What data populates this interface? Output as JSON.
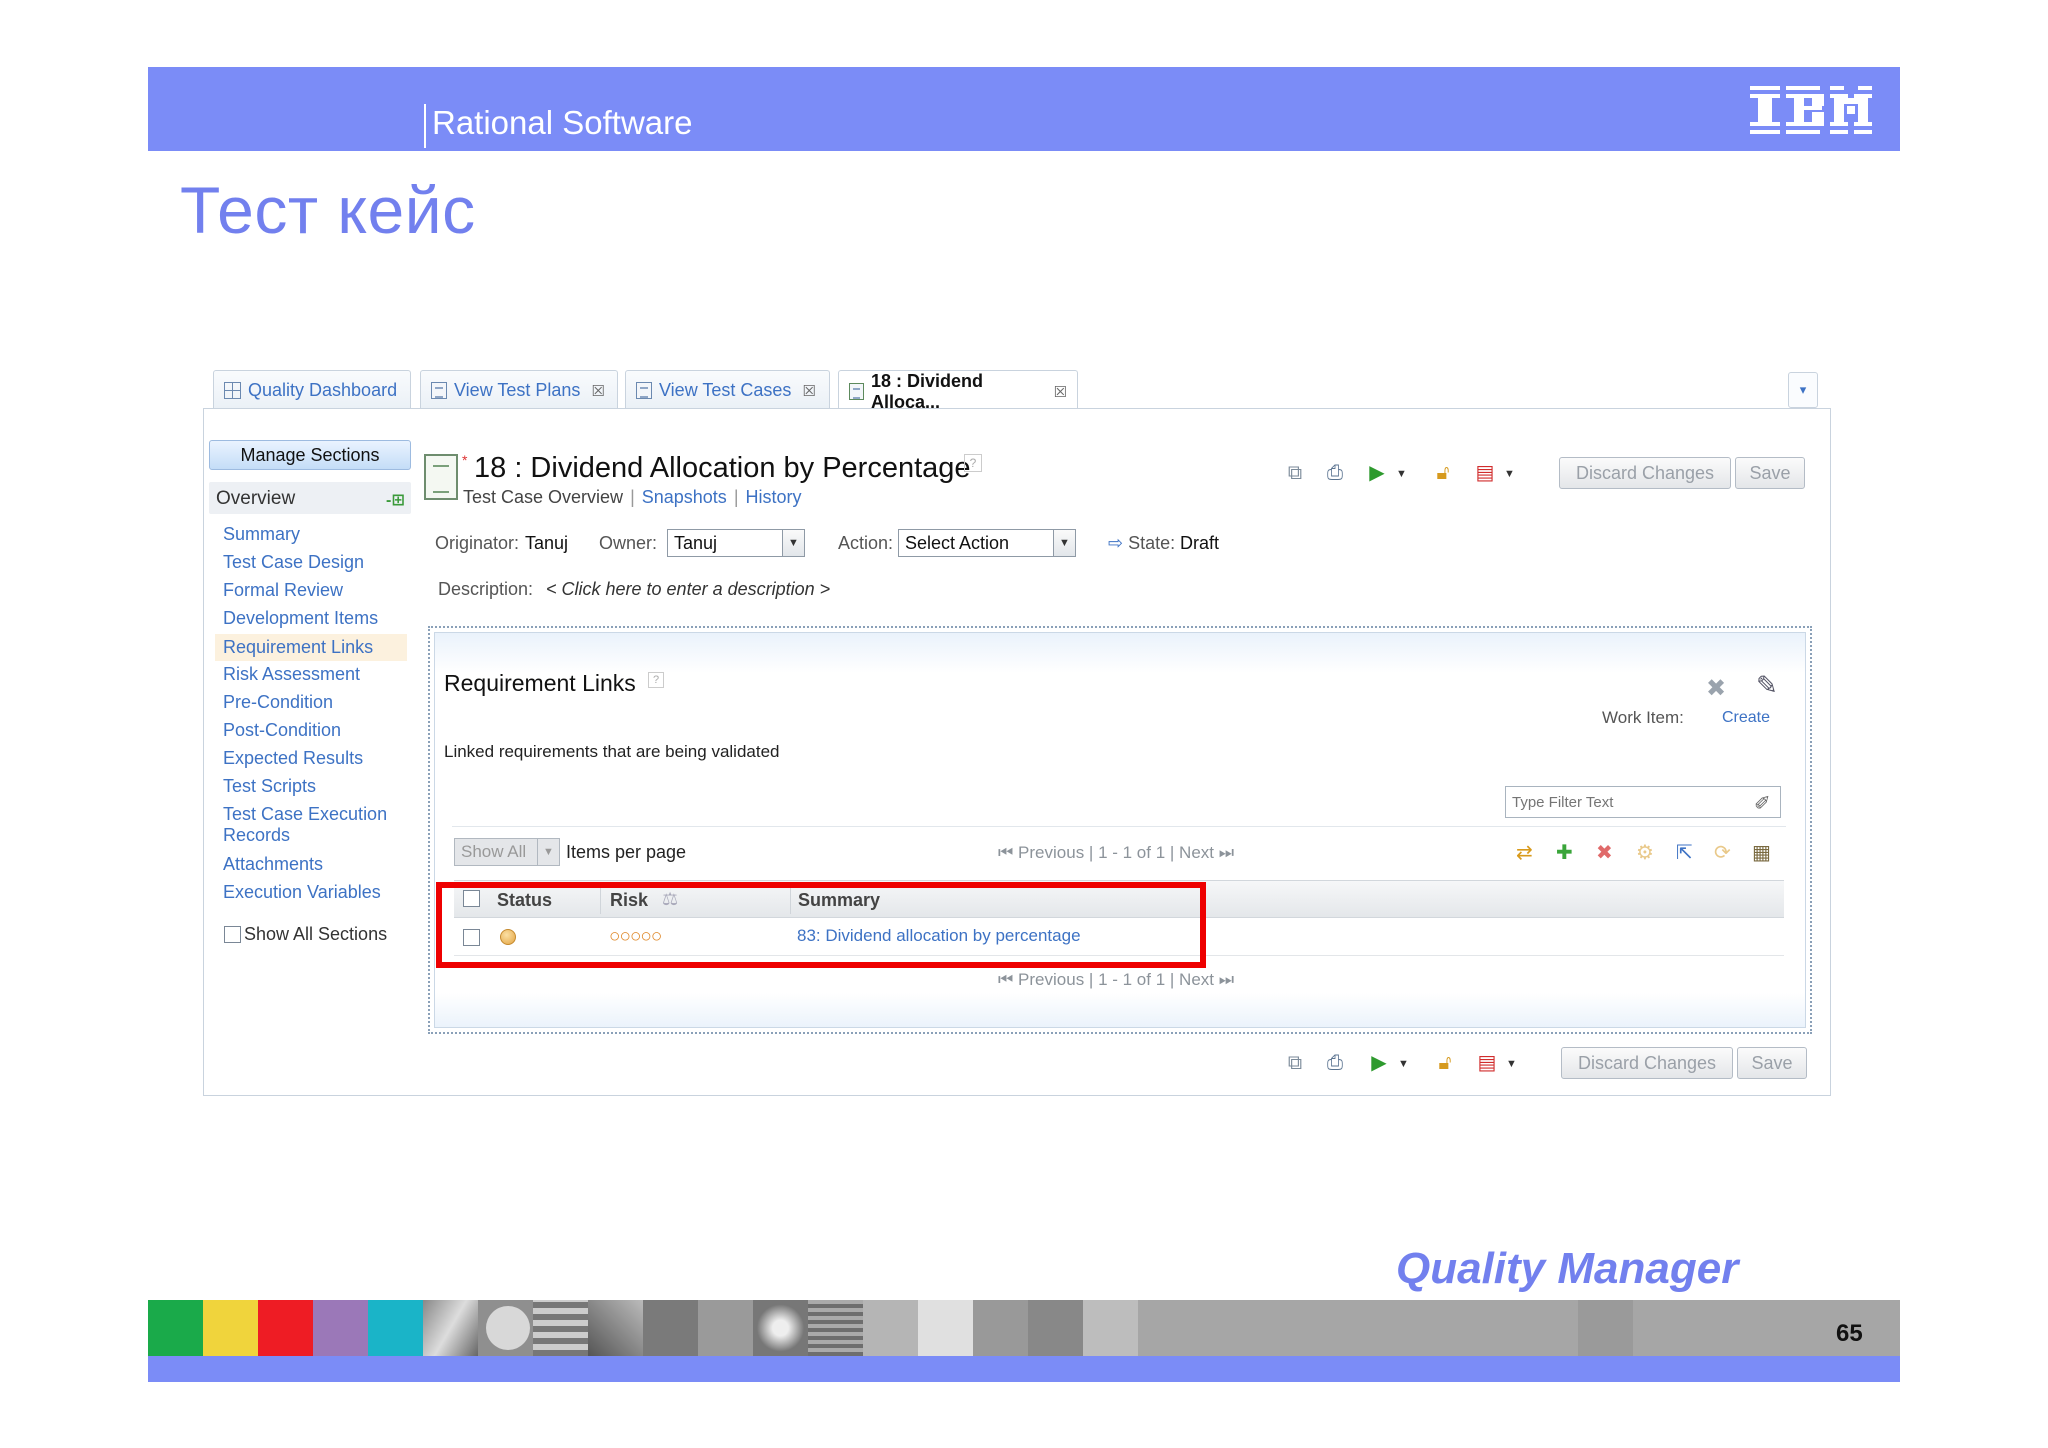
{
  "slide": {
    "brand": "Rational Software",
    "logo_text": "IBM",
    "title": "Тест кейс",
    "product": "Quality Manager",
    "page_number": "65"
  },
  "tabs": [
    {
      "label": "Quality Dashboard",
      "closable": false,
      "active": false
    },
    {
      "label": "View Test Plans",
      "closable": true,
      "active": false
    },
    {
      "label": "View Test Cases",
      "closable": true,
      "active": false
    },
    {
      "label": "18 : Dividend Alloca...",
      "closable": true,
      "active": true
    }
  ],
  "sidebar": {
    "manage_sections": "Manage Sections",
    "overview": "Overview",
    "items": [
      {
        "label": "Summary"
      },
      {
        "label": "Test Case Design"
      },
      {
        "label": "Formal Review"
      },
      {
        "label": "Development Items"
      },
      {
        "label": "Requirement Links"
      },
      {
        "label": "Risk Assessment"
      },
      {
        "label": "Pre-Condition"
      },
      {
        "label": "Post-Condition"
      },
      {
        "label": "Expected Results"
      },
      {
        "label": "Test Scripts"
      },
      {
        "label": "Test Case Execution Records"
      },
      {
        "label": "Attachments"
      },
      {
        "label": "Execution Variables"
      }
    ],
    "selected": "Requirement Links",
    "show_all_sections": "Show All Sections"
  },
  "test_case": {
    "dirty_marker": "*",
    "title": "18 :  Dividend Allocation by Percentage",
    "subnav": {
      "current": "Test Case Overview",
      "snapshots": "Snapshots",
      "history": "History"
    },
    "buttons": {
      "discard": "Discard Changes",
      "save": "Save"
    },
    "originator_label": "Originator:",
    "originator": "Tanuj",
    "owner_label": "Owner:",
    "owner": "Tanuj",
    "action_label": "Action:",
    "action": "Select Action",
    "state_label": "State:",
    "state": "Draft",
    "description_label": "Description:",
    "description_placeholder": "< Click here to enter a description >"
  },
  "requirement_links": {
    "title": "Requirement Links",
    "subtitle": "Linked requirements that are being validated",
    "work_item_label": "Work Item:",
    "create_link": "Create",
    "filter_placeholder": "Type Filter Text",
    "show_all": "Show All",
    "items_per_page": "Items per page",
    "pager": {
      "previous": "Previous",
      "range": "1 - 1 of 1",
      "next": "Next"
    },
    "columns": [
      "Status",
      "Risk",
      "Summary"
    ],
    "rows": [
      {
        "status": "in-progress",
        "risk": "○○○○○",
        "summary": "83: Dividend allocation by percentage"
      }
    ]
  },
  "colors": {
    "ibm_blue": "#7b8cf7",
    "title_blue": "#7280ee",
    "link_blue": "#3d72c4",
    "highlight_red": "#ee0000",
    "footer_palette": [
      "#1aaa4a",
      "#f0d43c",
      "#ee1c24",
      "#9b78b8",
      "#1ab4c8"
    ]
  }
}
